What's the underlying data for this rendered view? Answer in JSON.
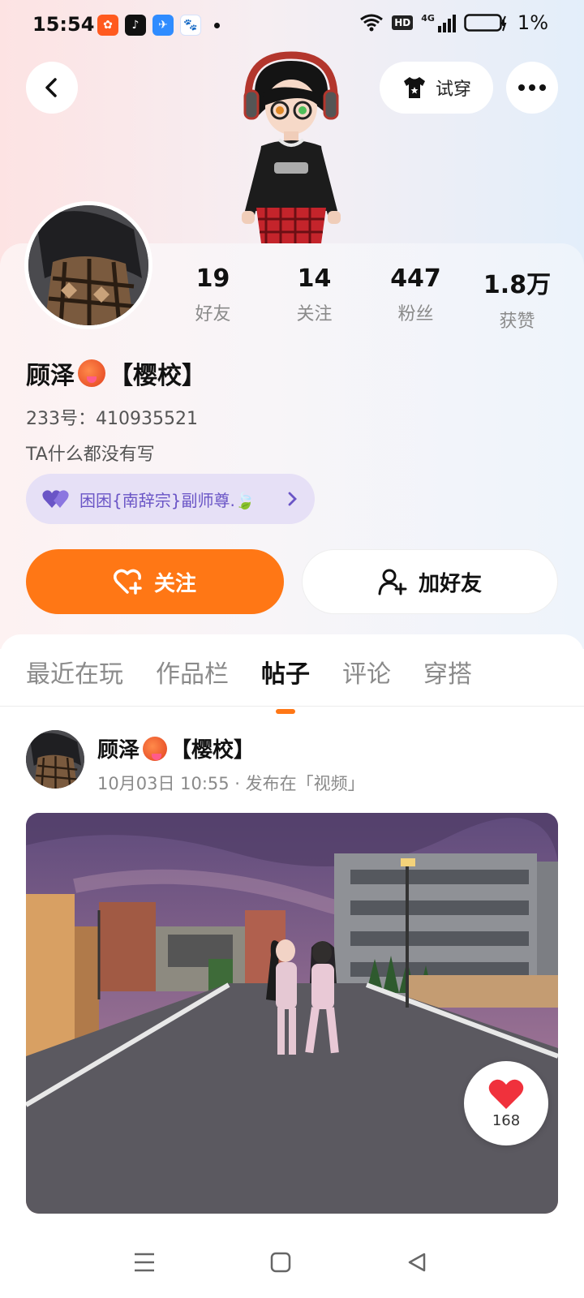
{
  "status_bar": {
    "time": "15:54",
    "network": "4G",
    "hd": "HD",
    "battery": "1%"
  },
  "header": {
    "try_on_label": "试穿"
  },
  "profile": {
    "stats": [
      {
        "value": "19",
        "label": "好友"
      },
      {
        "value": "14",
        "label": "关注"
      },
      {
        "value": "447",
        "label": "粉丝"
      },
      {
        "value": "1.8万",
        "label": "获赞"
      }
    ],
    "name": "顾泽",
    "name_suffix": "【樱校】",
    "uid": "233号：410935521",
    "bio": "TA什么都没有写",
    "cp_chip": "困困{南辞宗}副师尊.🍃"
  },
  "actions": {
    "follow_label": "关注",
    "add_friend_label": "加好友"
  },
  "tabs": [
    {
      "label": "最近在玩",
      "active": false
    },
    {
      "label": "作品栏",
      "active": false
    },
    {
      "label": "帖子",
      "active": true
    },
    {
      "label": "评论",
      "active": false
    },
    {
      "label": "穿搭",
      "active": false
    }
  ],
  "post": {
    "author": "顾泽",
    "author_suffix": "【樱校】",
    "meta": "10月03日 10:55 · 发布在「视频」",
    "likes": "168"
  },
  "colors": {
    "accent": "#ff7715",
    "chip_text": "#6a55c6",
    "like_red": "#f0313c"
  }
}
